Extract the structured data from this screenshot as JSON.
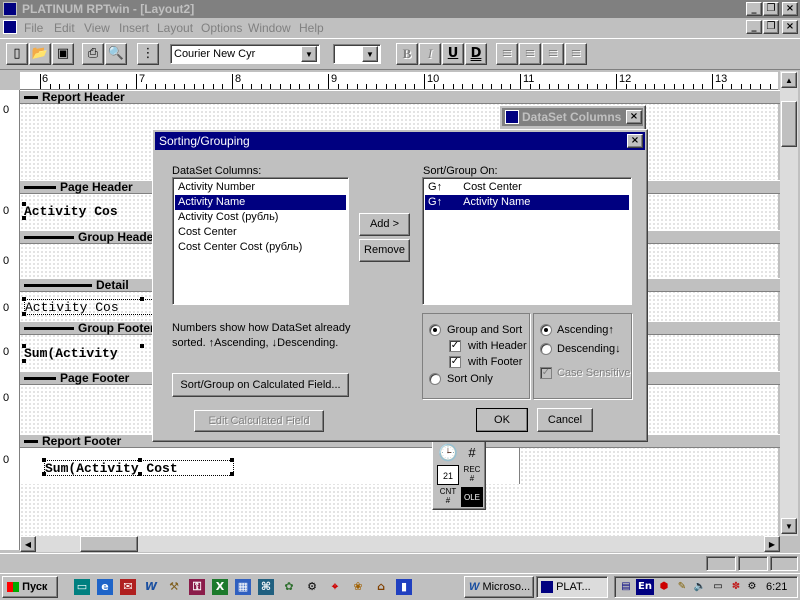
{
  "app": {
    "title": "PLATINUM RPTwin - [Layout2]",
    "menu": [
      "File",
      "Edit",
      "View",
      "Insert",
      "Layout",
      "Options",
      "Window",
      "Help"
    ],
    "font_name": "Courier New Cyr",
    "font_size": ""
  },
  "toolbar": {
    "bold": "B",
    "italic": "I",
    "underline": "U",
    "double_underline": "D"
  },
  "ruler": {
    "labels": [
      "6",
      "7",
      "8",
      "9",
      "10",
      "11",
      "12",
      "13"
    ]
  },
  "report": {
    "bands": {
      "report_header": "Report Header",
      "page_header": "Page Header",
      "group_header": "Group Heade",
      "detail": "Detail",
      "group_footer": "Group Footer",
      "page_footer": "Page Footer",
      "report_footer": "Report Footer"
    },
    "fields": {
      "page_header_field": "Activity Cos",
      "detail_field": "Activity Cos",
      "group_footer_field": "Sum(Activity",
      "report_footer_field": "Sum(Activity Cost"
    },
    "left_marks": [
      "0",
      "0",
      "0",
      "0",
      "0",
      "0",
      "0"
    ]
  },
  "dataset_panel": {
    "title": "DataSet Columns"
  },
  "dialog": {
    "title": "Sorting/Grouping",
    "columns_label": "DataSet Columns:",
    "columns": [
      "Activity Number",
      "Activity Name",
      "Activity Cost    (рубль)",
      "Cost Center",
      "Cost Center Cost (рубль)"
    ],
    "sort_label": "Sort/Group On:",
    "sort_items": [
      {
        "prefix": "G",
        "arrow": "↑",
        "name": "Cost Center"
      },
      {
        "prefix": "G",
        "arrow": "↑",
        "name": "Activity Name"
      }
    ],
    "add_button": "Add >",
    "remove_button": "Remove",
    "note_line1": "Numbers show how DataSet already",
    "note_line2": "sorted. ↑Ascending, ↓Descending.",
    "calc_button": "Sort/Group on Calculated Field...",
    "edit_calc_button": "Edit Calculated Field",
    "group_and_sort": "Group and Sort",
    "with_header": "with Header",
    "with_footer": "with Footer",
    "sort_only": "Sort Only",
    "ascending": "Ascending↑",
    "descending": "Descending↓",
    "case_sensitive": "Case Sensitive",
    "ok": "OK",
    "cancel": "Cancel"
  },
  "palette": {
    "rec": "REC",
    "rec_sym": "#",
    "cnt": "CNT",
    "cnt_sym": "#",
    "ole": "OLE"
  },
  "taskbar": {
    "start": "Пуск",
    "tasks": [
      "Microso...",
      "PLAT..."
    ],
    "clock": "6:21",
    "lang": "En"
  },
  "colors": {
    "title_active": "#000080",
    "desktop_bg": "#c0c0c0"
  }
}
